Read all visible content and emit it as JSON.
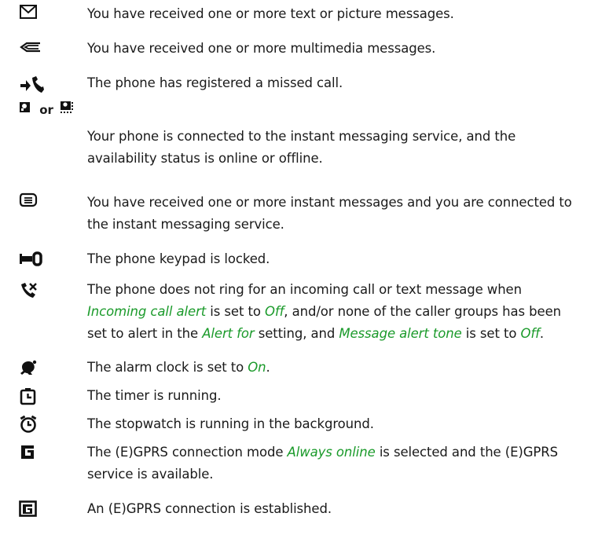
{
  "entries": {
    "text_messages": "You have received one or more text or picture messages.",
    "multimedia_messages": "You have received one or more multimedia messages.",
    "missed_call": "The phone has registered a missed call.",
    "or_word": "or",
    "im_connected": "Your phone is connected to the instant messaging service, and the availability status is online or offline.",
    "instant_messages": "You have received one or more instant messages and you are connected to the instant messaging service.",
    "keypad_locked": "The phone keypad is locked.",
    "silent": {
      "part1": "The phone does not ring for an incoming call or text message when ",
      "incoming_call_alert": "Incoming call alert",
      "part2": " is set to ",
      "off_1": "Off",
      "part3": ", and/or none of the caller groups has been set to alert in the ",
      "alert_for": "Alert for",
      "part4": " setting, and ",
      "message_alert_tone": "Message alert tone",
      "part5": " is set to ",
      "off_2": "Off",
      "part6": "."
    },
    "alarm": {
      "part1": "The alarm clock is set to ",
      "on": "On",
      "part2": "."
    },
    "timer": "The  timer is running.",
    "stopwatch": "The stopwatch is running in the background.",
    "gprs_mode": {
      "part1": "The (E)GPRS connection mode ",
      "always_online": "Always online",
      "part2": " is selected and the (E)GPRS service is available."
    },
    "gprs_established": "An (E)GPRS connection is established."
  },
  "icons": [
    "envelope-icon",
    "multimedia-message-icon",
    "missed-call-icon",
    "im-online-icon",
    "im-offline-icon",
    "instant-message-icon",
    "keypad-lock-icon",
    "silent-mode-icon",
    "alarm-clock-icon",
    "timer-icon",
    "stopwatch-icon",
    "gprs-always-online-icon",
    "gprs-connected-icon"
  ],
  "colors": {
    "text": "#1a1a1a",
    "emphasis": "#1a9a2a",
    "background": "#ffffff"
  }
}
